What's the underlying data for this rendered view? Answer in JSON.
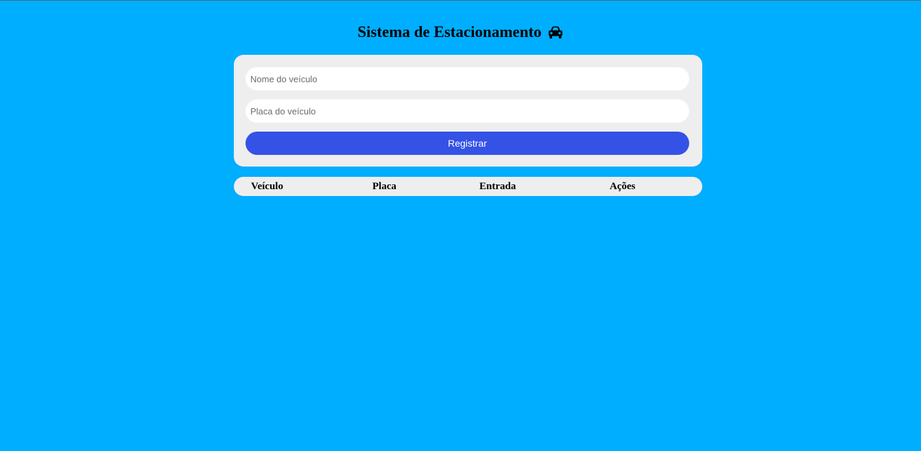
{
  "header": {
    "title": "Sistema de Estacionamento",
    "icon": "car-icon"
  },
  "form": {
    "vehicle_name": {
      "placeholder": "Nome do veículo",
      "value": ""
    },
    "vehicle_plate": {
      "placeholder": "Placa do veículo",
      "value": ""
    },
    "submit_label": "Registrar"
  },
  "table": {
    "columns": [
      "Veículo",
      "Placa",
      "Entrada",
      "Ações"
    ],
    "rows": []
  },
  "colors": {
    "background": "#00AEFF",
    "card": "#EEEEEE",
    "button": "#3452E6",
    "button_text": "#FFFFFF"
  }
}
